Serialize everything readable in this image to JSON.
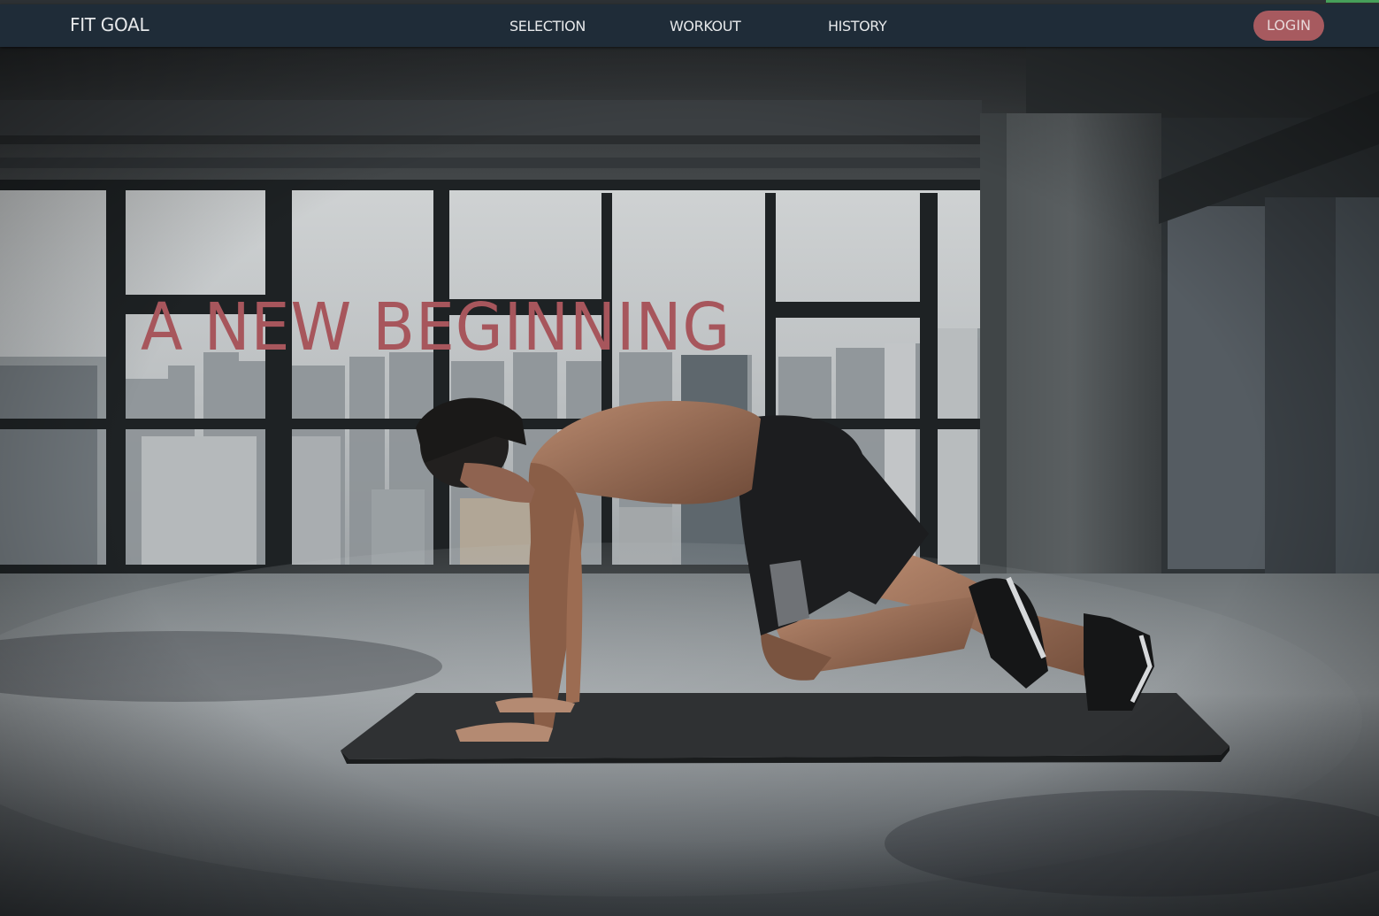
{
  "navbar": {
    "brand": "FIT GOAL",
    "links": [
      "SELECTION",
      "WORKOUT",
      "HISTORY"
    ],
    "login_label": "LOGIN"
  },
  "hero": {
    "title": "A NEW BEGINNING",
    "image_description_icon": "workout-photo"
  },
  "colors": {
    "navbar_bg": "#1f2c38",
    "accent": "#a75a5f",
    "title": "#a7565c",
    "nav_text": "#e6e8ea"
  }
}
